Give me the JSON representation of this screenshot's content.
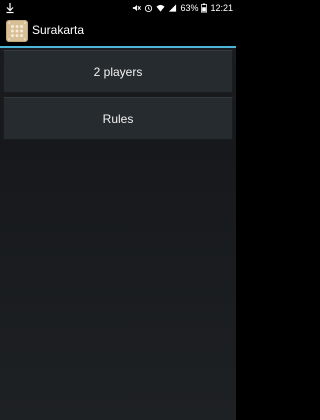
{
  "status_bar": {
    "battery_percent": "63%",
    "time": "12:21",
    "icons": [
      "download-icon",
      "mute-icon",
      "alarm-icon",
      "wifi-icon",
      "signal-icon",
      "battery-icon"
    ]
  },
  "action_bar": {
    "title": "Surakarta",
    "app_icon": "surakarta-board-icon",
    "accent_color": "#4cb5d8"
  },
  "menu": {
    "two_players_label": "2 players",
    "rules_label": "Rules"
  }
}
